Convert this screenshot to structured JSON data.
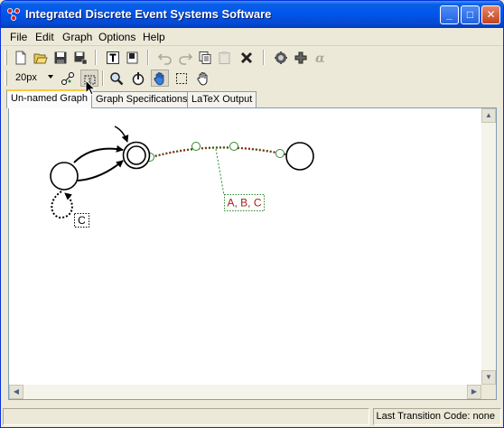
{
  "window": {
    "title": "Integrated Discrete Event Systems Software",
    "controls": {
      "minimize": "_",
      "maximize": "□",
      "close": "✕"
    }
  },
  "menu": {
    "items": [
      "File",
      "Edit",
      "Graph",
      "Options",
      "Help"
    ]
  },
  "toolbar1": {
    "buttons": [
      "new-icon",
      "open-icon",
      "save-icon",
      "save-as-icon",
      "text-label-icon",
      "export-icon",
      "undo-icon",
      "redo-icon",
      "copy-icon",
      "paste-icon",
      "delete-icon",
      "check-icon",
      "plugin-icon",
      "alpha-icon"
    ]
  },
  "toolbar2": {
    "grid_size": "20px",
    "buttons": [
      "edge-tool-icon",
      "select-tool-icon",
      "zoom-icon",
      "reset-view-icon",
      "hand-icon",
      "box-select-icon",
      "pan-icon"
    ]
  },
  "tabs": [
    "Un-named Graph",
    "Graph Specifications",
    "LaTeX Output"
  ],
  "graph": {
    "self_loop_label": "C",
    "edge_label": "A, B, C",
    "colors": {
      "edge_highlight": "#a0201e",
      "label_text": "#a0201e",
      "anchor_green": "#2e8b2e"
    }
  },
  "status": {
    "last_transition": "Last Transition Code:  none"
  }
}
